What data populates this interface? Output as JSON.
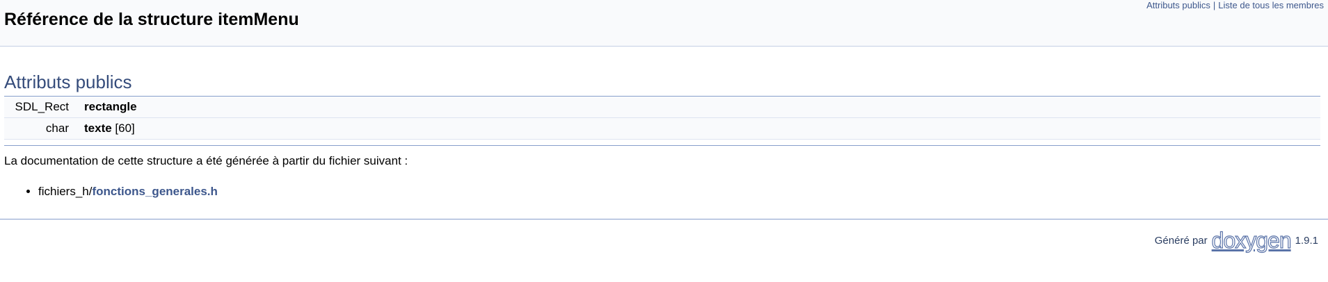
{
  "header": {
    "title": "Référence de la structure itemMenu",
    "summary_links": [
      "Attributs publics",
      "Liste de tous les membres"
    ],
    "summary_separator": "|"
  },
  "section": {
    "title": "Attributs publics",
    "members": [
      {
        "type": "SDL_Rect",
        "name": "rectangle",
        "suffix": ""
      },
      {
        "type": "char",
        "name": "texte",
        "suffix": " [60]"
      }
    ]
  },
  "generated_text": "La documentation de cette structure a été générée à partir du fichier suivant :",
  "files": [
    {
      "prefix": "fichiers_h/",
      "name": "fonctions_generales.h"
    }
  ],
  "footer": {
    "generated_by": "Généré par",
    "logo_text": "doxygen",
    "version": "1.9.1"
  }
}
